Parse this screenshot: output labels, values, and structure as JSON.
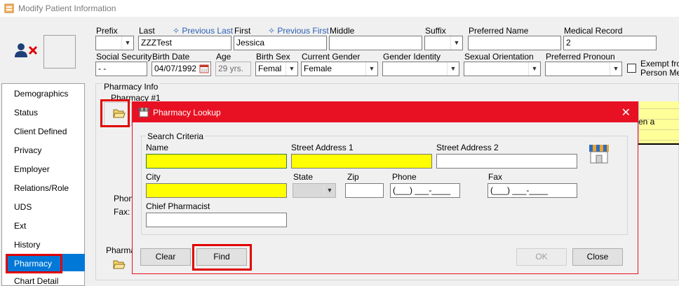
{
  "window": {
    "title": "Modify Patient Information"
  },
  "header": {
    "prefix_label": "Prefix",
    "last_label": "Last",
    "previous_last_link": "Previous Last",
    "last_value": "ZZZTest",
    "first_label": "First",
    "previous_first_link": "Previous First",
    "first_value": "Jessica",
    "middle_label": "Middle",
    "suffix_label": "Suffix",
    "preferred_name_label": "Preferred Name",
    "medical_record_label": "Medical Record",
    "medical_record_value": "2",
    "ssn_label": "Social Security",
    "ssn_value": "-   -",
    "birth_date_label": "Birth Date",
    "birth_date_value": "04/07/1992",
    "age_label": "Age",
    "age_value": "29 yrs.",
    "birth_sex_label": "Birth Sex",
    "birth_sex_value": "Femal",
    "current_gender_label": "Current Gender",
    "current_gender_value": "Female",
    "gender_identity_label": "Gender Identity",
    "sexual_orientation_label": "Sexual Orientation",
    "preferred_pronoun_label": "Preferred Pronoun",
    "exempt_label_1": "Exempt from",
    "exempt_label_2": "Person Merg"
  },
  "sidebar": {
    "items": [
      "Demographics",
      "Status",
      "Client Defined",
      "Privacy",
      "Employer",
      "Relations/Role",
      "UDS",
      "Ext",
      "History",
      "Pharmacy",
      "Chart Detail"
    ]
  },
  "pharmacy_panel": {
    "section_label": "Pharmacy Info",
    "pharmacy1_label": "Pharmacy #1",
    "phone_label": "Phone",
    "fax_label": "Fax:",
    "pharmacy2_label": "Pharma",
    "right_text": "en a"
  },
  "dialog": {
    "title": "Pharmacy Lookup",
    "close_glyph": "✕",
    "group_label": "Search Criteria",
    "name_label": "Name",
    "street1_label": "Street Address 1",
    "street2_label": "Street Address 2",
    "city_label": "City",
    "state_label": "State",
    "zip_label": "Zip",
    "phone_label": "Phone",
    "fax_label": "Fax",
    "phone_placeholder": "(___) ___-____",
    "fax_placeholder": "(___) ___-____",
    "chief_label": "Chief Pharmacist",
    "clear_button": "Clear",
    "find_button": "Find",
    "ok_button": "OK",
    "close_button": "Close"
  },
  "colors": {
    "accent_red": "#e81123",
    "highlight_red": "#e00000",
    "required_yellow": "#ffff00",
    "selection_blue": "#0078d7",
    "link_blue": "#2b5fb4"
  },
  "icons": [
    "app-icon",
    "remove-user-icon",
    "folder-open-icon",
    "store-icon",
    "calendar-icon",
    "chevron-down-icon",
    "close-icon"
  ]
}
